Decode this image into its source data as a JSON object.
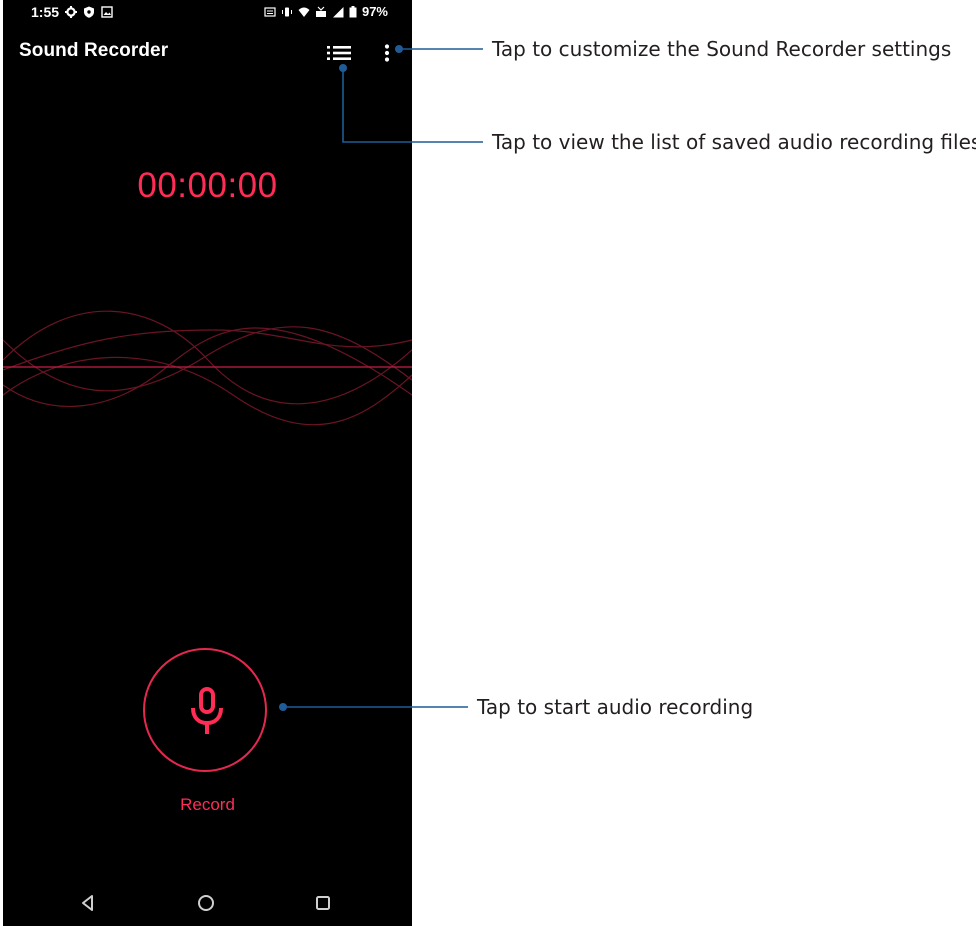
{
  "status_bar": {
    "time": "1:55",
    "battery_percent": "97%",
    "icons": [
      "gear-icon",
      "shield-icon",
      "image-icon",
      "nfc-icon",
      "vibrate-icon",
      "wifi-icon",
      "volte-icon",
      "signal-icon",
      "battery-icon"
    ]
  },
  "app_bar": {
    "title": "Sound Recorder",
    "list_icon": "list-icon",
    "more_icon": "more-vert-icon"
  },
  "recorder": {
    "timer": "00:00:00",
    "record_label": "Record",
    "accent_color": "#ff2c55"
  },
  "nav_bar": {
    "icons": [
      "back-icon",
      "home-icon",
      "recents-icon"
    ]
  },
  "callouts": {
    "settings": "Tap to customize the Sound Recorder settings",
    "list": "Tap to view the list of saved audio recording files",
    "record": "Tap to start audio recording",
    "line_color": "#1f5c97"
  }
}
